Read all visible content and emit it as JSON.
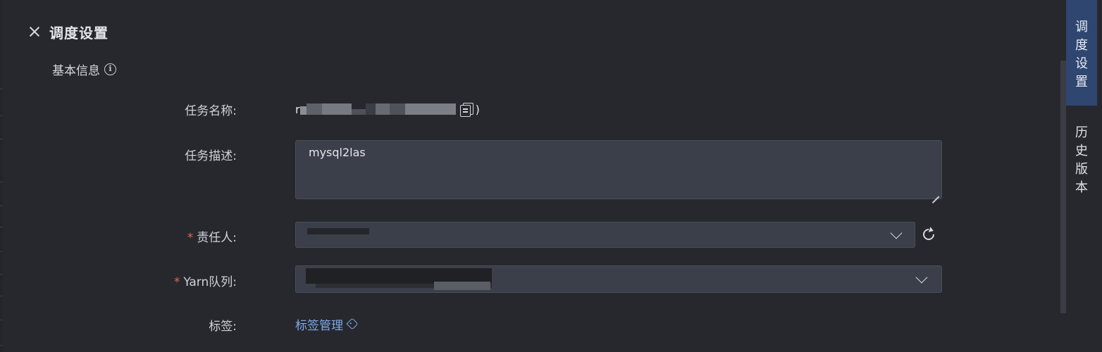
{
  "header": {
    "title": "调度设置"
  },
  "section": {
    "title": "基本信息"
  },
  "form": {
    "name_label": "任务名称:",
    "name_value_prefix": "r",
    "name_value_suffix": ")",
    "desc_label": "任务描述:",
    "desc_value": "mysql2las",
    "owner_label": "责任人:",
    "yarn_label": "Yarn队列:",
    "tags_label": "标签:",
    "tags_link": "标签管理",
    "required_mark": "*"
  },
  "side_tabs": [
    {
      "chars": [
        "调",
        "度",
        "设",
        "置"
      ],
      "active": true
    },
    {
      "chars": [
        "历",
        "史",
        "版",
        "本"
      ],
      "active": false
    }
  ],
  "colors": {
    "accent_link": "#7fa9ea",
    "required": "#e06552",
    "active_tab": "#2f4670"
  },
  "icons": [
    "close-icon",
    "info-icon",
    "copy-icon",
    "chevron-down-icon",
    "refresh-icon",
    "tag-icon"
  ]
}
